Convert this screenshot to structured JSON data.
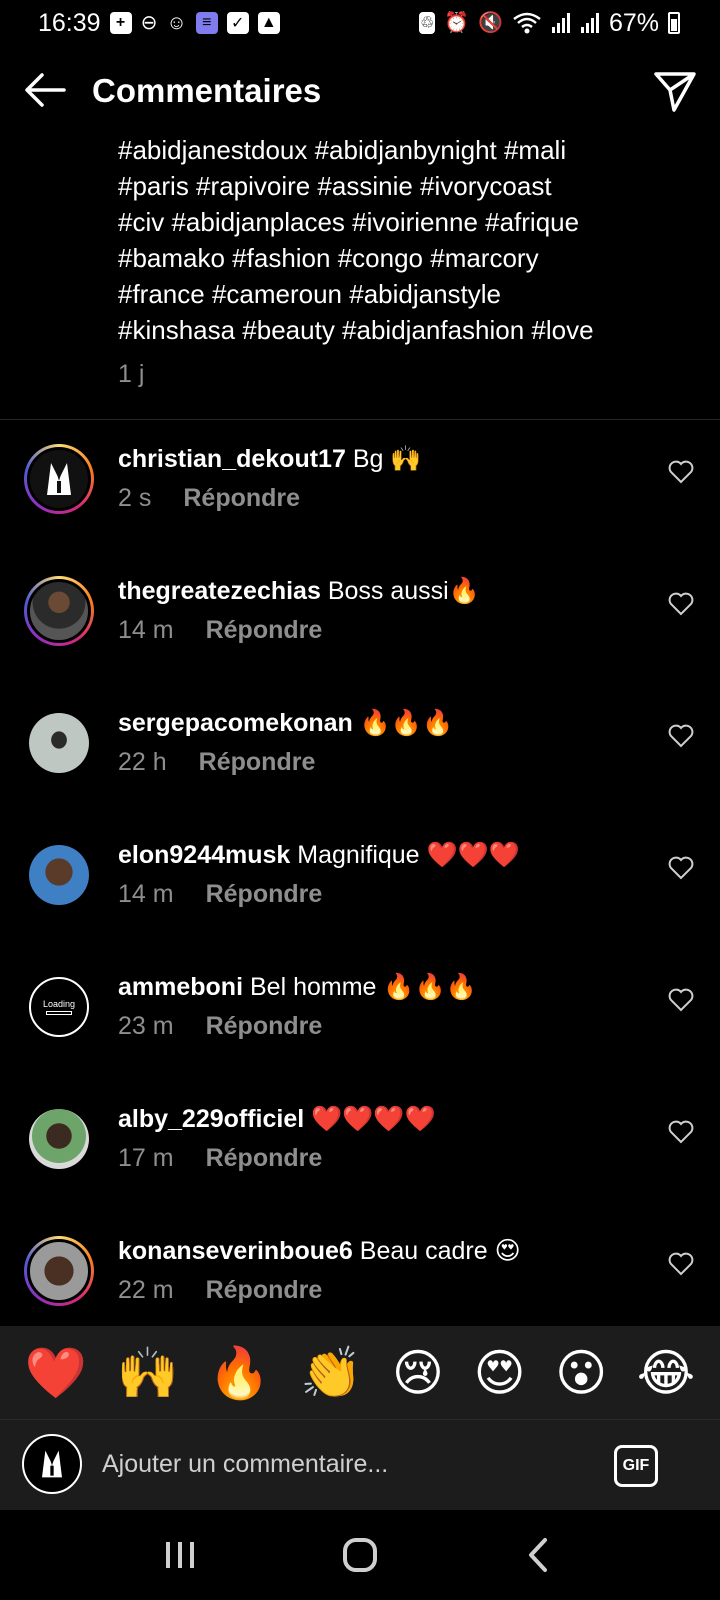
{
  "status_bar": {
    "time": "16:39",
    "battery": "67%",
    "left_icons": [
      "plus-box-icon",
      "minus-circle-icon",
      "headphones-icon",
      "list-app-icon",
      "check-box-icon",
      "image-icon"
    ],
    "right_icons": [
      "nfc-icon",
      "alarm-icon",
      "mute-icon",
      "wifi-icon",
      "signal-icon",
      "signal-icon",
      "battery-icon"
    ]
  },
  "header": {
    "title": "Commentaires",
    "back_icon": "back-arrow-icon",
    "share_icon": "send-icon"
  },
  "caption": {
    "lines": [
      "#abidjanestdoux #abidjanbynight #mali",
      "#paris #rapivoire #assinie #ivorycoast",
      "#civ #abidjanplaces #ivoirienne #afrique",
      "#bamako #fashion #congo #marcory",
      "#france #cameroun #abidjanstyle",
      "#kinshasa #beauty #abidjanfashion #love"
    ],
    "time": "1 j"
  },
  "comments": [
    {
      "username": "christian_dekout17",
      "text": "Bg 🙌",
      "time": "2 s",
      "reply": "Répondre",
      "story": true,
      "avatar": "tuxedo"
    },
    {
      "username": "thegreatezechias",
      "text": "Boss aussi🔥",
      "time": "14 m",
      "reply": "Répondre",
      "story": true,
      "avatar": "photo"
    },
    {
      "username": "sergepacomekonan",
      "text": "🔥🔥🔥",
      "time": "22 h",
      "reply": "Répondre",
      "story": false,
      "avatar": "photo-light"
    },
    {
      "username": "elon9244musk",
      "text": "Magnifique ❤️❤️❤️",
      "time": "14 m",
      "reply": "Répondre",
      "story": false,
      "avatar": "photo-blue"
    },
    {
      "username": "ammeboni",
      "text": "Bel homme 🔥🔥🔥",
      "time": "23 m",
      "reply": "Répondre",
      "story": false,
      "avatar": "loading"
    },
    {
      "username": "alby_229officiel",
      "text": "❤️❤️❤️❤️",
      "time": "17 m",
      "reply": "Répondre",
      "story": false,
      "avatar": "photo-green"
    },
    {
      "username": "konanseverinboue6",
      "text": "Beau cadre 😍",
      "time": "22 m",
      "reply": "Répondre",
      "story": true,
      "avatar": "photo"
    }
  ],
  "avatar_text": {
    "loading": "Loading"
  },
  "emoji_bar": [
    "❤️",
    "🙌",
    "🔥",
    "👏",
    "😢",
    "😍",
    "😮",
    "😂"
  ],
  "input": {
    "placeholder": "Ajouter un commentaire...",
    "gif_label": "GIF"
  },
  "nav_bar": [
    "recent-apps-icon",
    "home-icon",
    "back-icon"
  ]
}
